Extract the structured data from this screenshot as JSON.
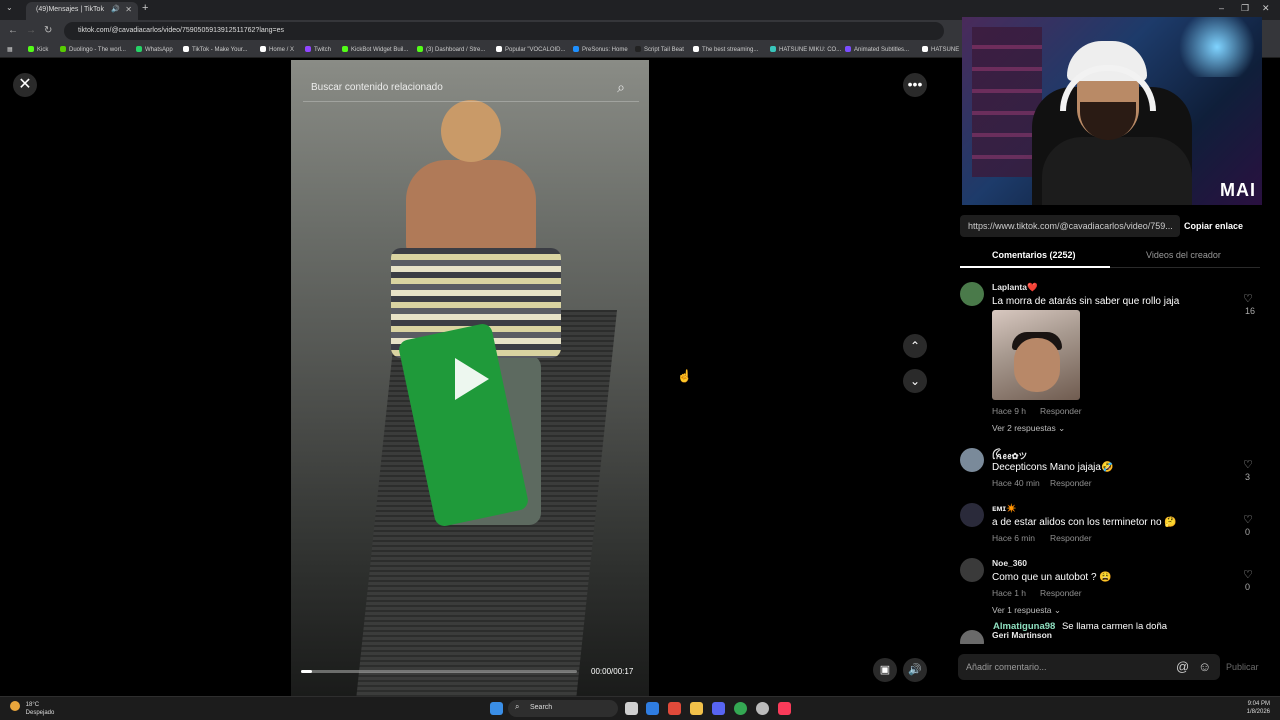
{
  "browser": {
    "tab_title": "(49)Mensajes | TikTok",
    "tab_menu_icon": "chevron-down-icon",
    "url": "tiktok.com/@cavadiacarlos/video/7590505913912511762?lang=es",
    "bookmarks": [
      {
        "label": "Kick",
        "color": "#53fc18"
      },
      {
        "label": "Duolingo - The worl...",
        "color": "#58cc02"
      },
      {
        "label": "WhatsApp",
        "color": "#25d366"
      },
      {
        "label": "TikTok - Make Your...",
        "color": "#ffffff"
      },
      {
        "label": "Home / X",
        "color": "#ffffff"
      },
      {
        "label": "Twitch",
        "color": "#9146ff"
      },
      {
        "label": "KickBot Widget Buil...",
        "color": "#53fc18"
      },
      {
        "label": "(3) Dashboard / Stre...",
        "color": "#53fc18"
      },
      {
        "label": "Popular \"VOCALOID...",
        "color": "#ffffff"
      },
      {
        "label": "PreSonus: Home",
        "color": "#1e90ff"
      },
      {
        "label": "Script Tail Beat",
        "color": "#222222"
      },
      {
        "label": "The best streaming...",
        "color": "#ffffff"
      },
      {
        "label": "HATSUNE MIKU: CO...",
        "color": "#39c5bb"
      },
      {
        "label": "Animated Subtitles...",
        "color": "#7b4dff"
      },
      {
        "label": "HATSUNE",
        "color": "#ffffff"
      }
    ]
  },
  "video": {
    "search_placeholder": "Buscar contenido relacionado",
    "time": "00:00/00:17",
    "progress": 0.04
  },
  "webcam": {
    "logo": "MAI"
  },
  "share": {
    "url": "https://www.tiktok.com/@cavadiacarlos/video/759...",
    "copy_label": "Copiar enlace"
  },
  "tabs": {
    "comments": "Comentarios (2252)",
    "creator_videos": "Videos del creador"
  },
  "comments": [
    {
      "user": "Laplanta❤️",
      "text": "La morra de atarás sin saber que rollo jaja",
      "time": "Hace 9 h",
      "reply": "Responder",
      "likes": "16",
      "more": "Ver 2 respuestas ⌄",
      "avatar_color": "#4a7a4a"
    },
    {
      "user": "ꪶꫝꫀꫀ✿ツ",
      "text": "Decepticons Mano jajaja🤣",
      "time": "Hace 40 min",
      "reply": "Responder",
      "likes": "3",
      "avatar_color": "#7a8a9a"
    },
    {
      "user": "ᴇᴍɪ✴️",
      "text": "a de estar alidos con los terminetor no 🤔",
      "time": "Hace 6 min",
      "reply": "Responder",
      "likes": "0",
      "avatar_color": "#2a2a3a"
    },
    {
      "user": "Noe_360",
      "text": "Como que un autobot ? 😩",
      "time": "Hace 1 h",
      "reply": "Responder",
      "likes": "0",
      "more": "Ver 1 respuesta ⌄",
      "avatar_color": "#3a3a3a"
    },
    {
      "user": "Geri Martinson",
      "avatar_color": "#6a6a6a"
    }
  ],
  "composer": {
    "placeholder": "Añadir comentario...",
    "post_label": "Publicar"
  },
  "chat_overlay": {
    "user": "Almatiguna98",
    "message": "Se llama carmen la doña"
  },
  "taskbar": {
    "temperature": "18°C",
    "weather": "Despejado",
    "search": "Search",
    "time": "9:04 PM",
    "date": "1/8/2026"
  }
}
